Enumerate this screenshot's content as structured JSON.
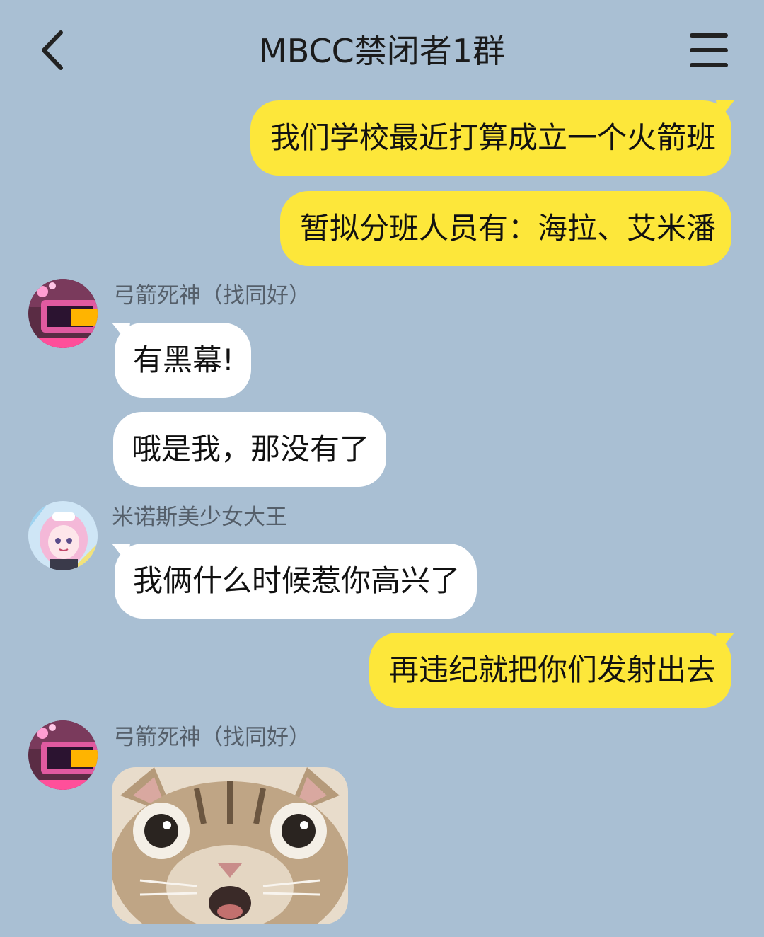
{
  "header": {
    "title": "MBCC禁闭者1群",
    "back_icon": "chevron-left-icon",
    "menu_icon": "hamburger-menu-icon"
  },
  "colors": {
    "background": "#a9bfd3",
    "my_bubble": "#fde73a",
    "other_bubble": "#ffffff"
  },
  "messages": [
    {
      "from": "me",
      "text": "我们学校最近打算成立一个火箭班"
    },
    {
      "from": "me",
      "text": "暂拟分班人员有：海拉、艾米潘"
    },
    {
      "from": "弓箭死神（找同好）",
      "text": "有黑幕!"
    },
    {
      "from": "弓箭死神（找同好）",
      "text": "哦是我，那没有了"
    },
    {
      "from": "米诺斯美少女大王",
      "text": "我俩什么时候惹你高兴了"
    },
    {
      "from": "me",
      "text": "再违纪就把你们发射出去"
    },
    {
      "from": "弓箭死神（找同好）",
      "type": "image",
      "image": "startled-cat-sticker"
    }
  ],
  "senders": {
    "s1": "弓箭死神（找同好）",
    "s2": "米诺斯美少女大王",
    "s3": "弓箭死神（找同好）"
  }
}
